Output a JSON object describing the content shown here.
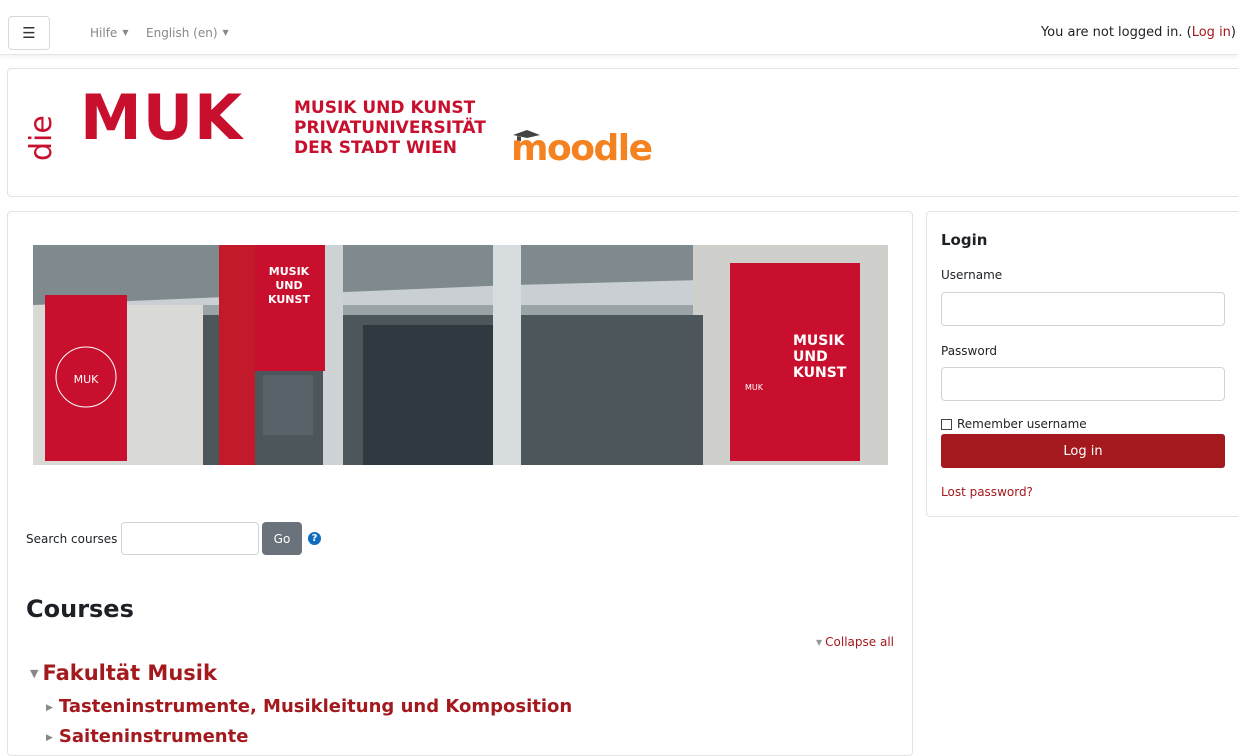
{
  "navbar": {
    "menu_icon": "hamburger-icon",
    "help_label": "Hilfe",
    "language_label": "English (en)",
    "login_status_text": "You are not logged in.",
    "login_link": "Log in"
  },
  "header": {
    "logo_die": "die",
    "logo_muk": "MUK",
    "logo_sub_lines": [
      "MUSIK UND KUNST",
      "PRIVATUNIVERSITÄT",
      "DER STADT WIEN"
    ],
    "moodle_logo": "moodle"
  },
  "hero": {
    "banner_text_1": "MUSIK UND KUNST",
    "banner_text_2": "MUSIK UND KUNST",
    "banner_text_3": "MUSIK UND KUNST"
  },
  "search": {
    "label": "Search courses",
    "button": "Go",
    "help_icon": "question-circle-icon"
  },
  "courses": {
    "title": "Courses",
    "collapse_all": "Collapse all",
    "top_category": "Fakultät Musik",
    "subcategories": [
      "Tasteninstrumente, Musikleitung und Komposition",
      "Saiteninstrumente"
    ]
  },
  "login": {
    "title": "Login",
    "username_label": "Username",
    "password_label": "Password",
    "remember_label": "Remember username",
    "button": "Log in",
    "lost_password": "Lost password?"
  },
  "colors": {
    "brand_red": "#a3191d",
    "logo_red": "#c8102e",
    "moodle_orange": "#f58220"
  }
}
